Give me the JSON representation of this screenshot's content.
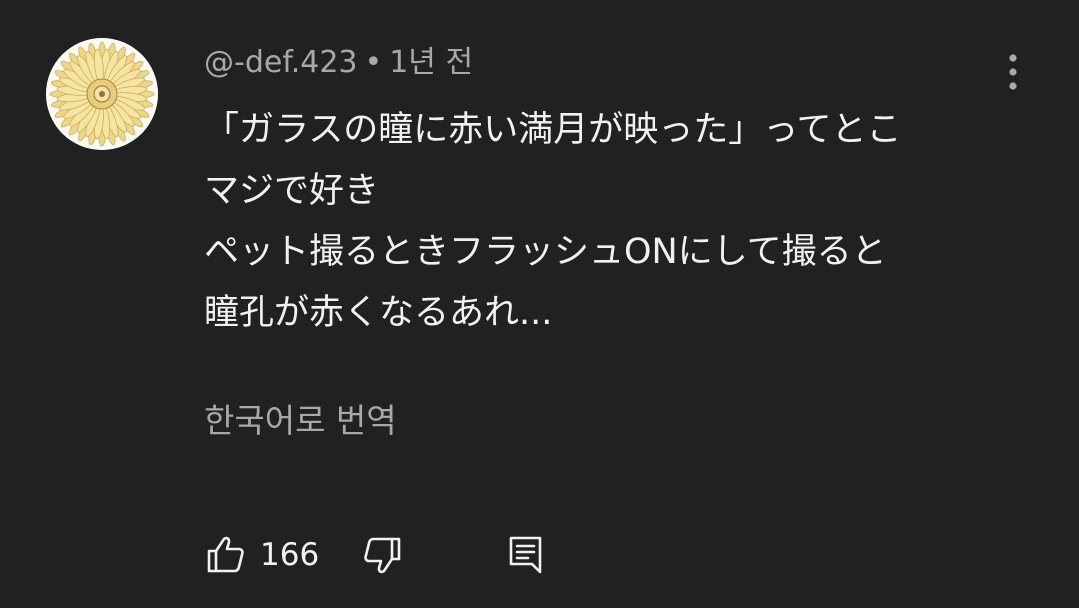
{
  "comment": {
    "author": "@-def.423",
    "separator": "•",
    "time": "1년 전",
    "lines": [
      "「ガラスの瞳に赤い満月が映った」ってとこ",
      "マジで好き",
      "ペット撮るときフラッシュONにして撮ると",
      "瞳孔が赤くなるあれ..."
    ],
    "translate_label": "한국어로 번역",
    "like_count": "166"
  },
  "icons": {
    "avatar": "sunflower-avatar",
    "menu": "more-vert-icon",
    "like": "thumb-up-icon",
    "dislike": "thumb-down-icon",
    "reply": "reply-comment-icon"
  },
  "colors": {
    "background": "#212121",
    "primary_text": "#f1f1f1",
    "secondary_text": "#a8a8a8",
    "avatar_petal": "#f0d98a"
  }
}
